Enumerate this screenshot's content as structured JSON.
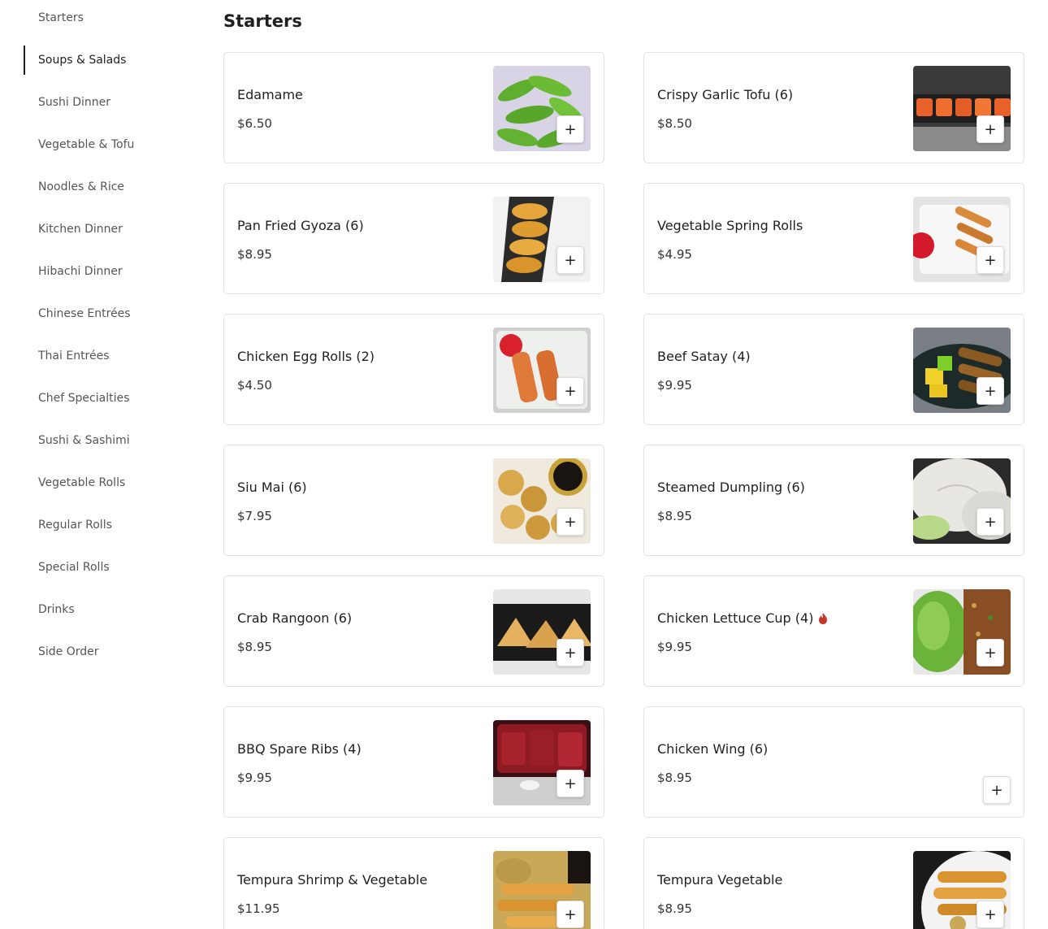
{
  "categories": [
    {
      "label": "Starters"
    },
    {
      "label": "Soups & Salads"
    },
    {
      "label": "Sushi Dinner"
    },
    {
      "label": "Vegetable & Tofu"
    },
    {
      "label": "Noodles & Rice"
    },
    {
      "label": "Kitchen Dinner"
    },
    {
      "label": "Hibachi Dinner"
    },
    {
      "label": "Chinese Entrées"
    },
    {
      "label": "Thai Entrées"
    },
    {
      "label": "Chef Specialties"
    },
    {
      "label": "Sushi & Sashimi"
    },
    {
      "label": "Vegetable Rolls"
    },
    {
      "label": "Regular Rolls"
    },
    {
      "label": "Special Rolls"
    },
    {
      "label": "Drinks"
    },
    {
      "label": "Side Order"
    }
  ],
  "active_category": "Soups & Salads",
  "section_title": "Starters",
  "add_label": "+",
  "items": [
    {
      "name": "Edamame",
      "price": "$6.50",
      "image": "edamame-photo"
    },
    {
      "name": "Crispy Garlic Tofu (6)",
      "price": "$8.50",
      "image": "garlic-tofu-photo"
    },
    {
      "name": "Pan Fried Gyoza (6)",
      "price": "$8.95",
      "image": "gyoza-photo"
    },
    {
      "name": "Vegetable Spring Rolls",
      "price": "$4.95",
      "image": "spring-rolls-photo"
    },
    {
      "name": "Chicken Egg Rolls (2)",
      "price": "$4.50",
      "image": "egg-rolls-photo"
    },
    {
      "name": "Beef Satay (4)",
      "price": "$9.95",
      "image": "beef-satay-photo"
    },
    {
      "name": "Siu Mai (6)",
      "price": "$7.95",
      "image": "siu-mai-photo"
    },
    {
      "name": "Steamed Dumpling (6)",
      "price": "$8.95",
      "image": "steamed-dumpling-photo"
    },
    {
      "name": "Crab Rangoon (6)",
      "price": "$8.95",
      "image": "crab-rangoon-photo"
    },
    {
      "name": "Chicken Lettuce Cup (4)",
      "price": "$9.95",
      "image": "lettuce-cup-photo",
      "spicy": true
    },
    {
      "name": "BBQ Spare Ribs (4)",
      "price": "$9.95",
      "image": "spare-ribs-photo"
    },
    {
      "name": "Chicken Wing (6)",
      "price": "$8.95",
      "image": null
    },
    {
      "name": "Tempura Shrimp & Vegetable",
      "price": "$11.95",
      "image": "tempura-shrimp-photo"
    },
    {
      "name": "Tempura Vegetable",
      "price": "$8.95",
      "image": "tempura-vegetable-photo"
    }
  ],
  "colors": {
    "text": "#1f1f1f",
    "muted": "#555555",
    "border": "#e2e2e2",
    "spicy": "#c0392b"
  }
}
